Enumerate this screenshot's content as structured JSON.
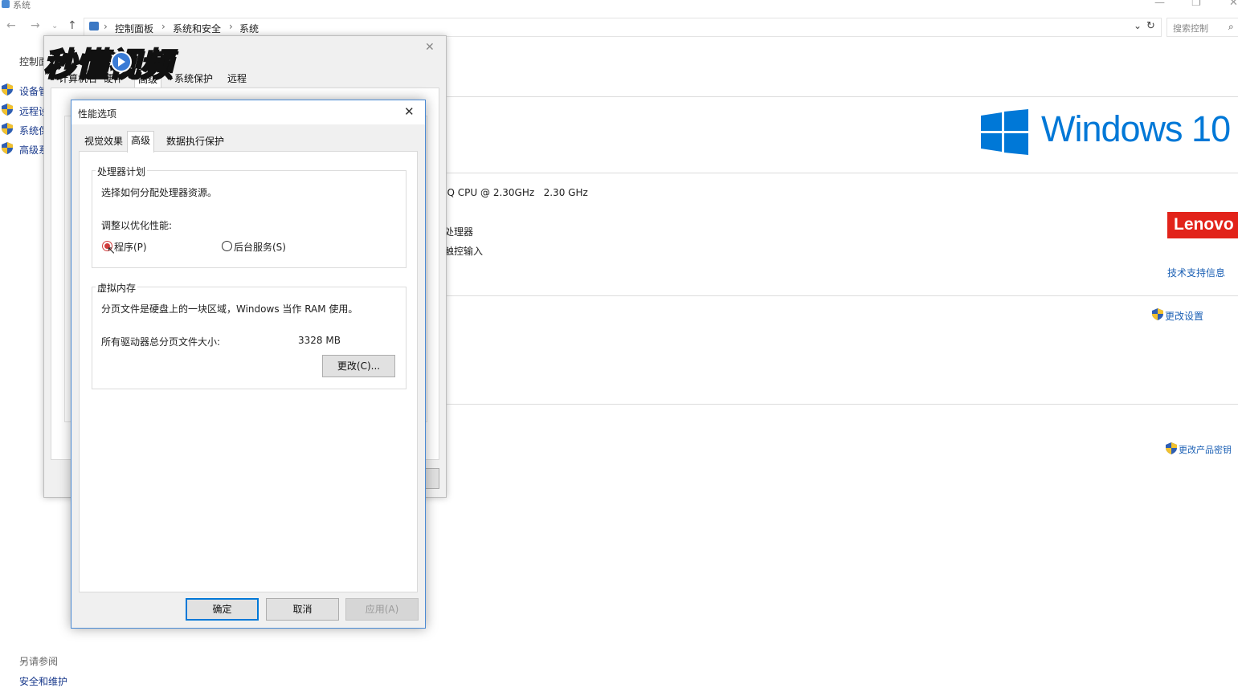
{
  "window": {
    "title": "系统"
  },
  "breadcrumb": {
    "items": [
      "控制面板",
      "系统和安全",
      "系统"
    ]
  },
  "search": {
    "placeholder": "搜索控制"
  },
  "left_pane": {
    "home": "控制面",
    "links": [
      "设备管",
      "远程设",
      "系统保",
      "高级系"
    ],
    "see_also": "另请参阅",
    "security": "安全和维护"
  },
  "main": {
    "brand": "Windows 10",
    "cpu": "IQ CPU @ 2.30GHz   2.30 GHz",
    "system_type": "处理器",
    "pen_touch": "触控输入",
    "oem": "Lenovo",
    "support": "技术支持信息",
    "change_settings": "更改设置",
    "change_key": "更改产品密钥"
  },
  "sys_dialog": {
    "tabs": [
      "计算机名",
      "硬件",
      "高级",
      "系统保护",
      "远程"
    ]
  },
  "perf_dialog": {
    "title": "性能选项",
    "tabs": [
      "视觉效果",
      "高级",
      "数据执行保护"
    ],
    "active_tab": "高级",
    "processor": {
      "title": "处理器计划",
      "desc": "选择如何分配处理器资源。",
      "adjust": "调整以优化性能:",
      "opt_programs": "程序(P)",
      "opt_background": "后台服务(S)",
      "selected": "程序(P)"
    },
    "vm": {
      "title": "虚拟内存",
      "desc": "分页文件是硬盘上的一块区域，Windows 当作 RAM 使用。",
      "total_label": "所有驱动器总分页文件大小:",
      "total_value": "3328 MB",
      "change": "更改(C)..."
    },
    "buttons": {
      "ok": "确定",
      "cancel": "取消",
      "apply": "应用(A)"
    }
  },
  "watermark": {
    "text": "秒懂视频"
  },
  "colors": {
    "accent": "#1a5fb4",
    "win_blue": "#0078d7",
    "lenovo": "#e2231a",
    "radio_selected": "#d23c3c"
  }
}
